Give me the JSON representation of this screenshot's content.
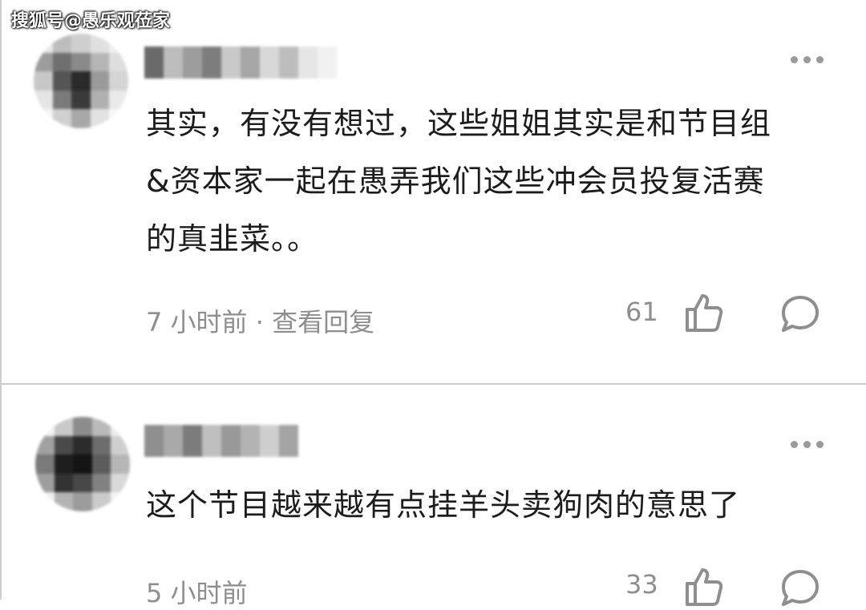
{
  "watermark": "搜狐号@愚乐观莅家",
  "comments": [
    {
      "lines": [
        "其实，有没有想过，这些姐姐其实是和节目组",
        "&资本家一起在愚弄我们这些冲会员投复活赛",
        "的真韭菜。。"
      ],
      "time": "7 小时前",
      "separator": "·",
      "reply_link": "查看回复",
      "likes": "61"
    },
    {
      "lines": [
        "这个节目越来越有点挂羊头卖狗肉的意思了"
      ],
      "time": "5 小时前",
      "likes": "33"
    }
  ],
  "icons": {
    "more": "more-dots-icon",
    "like": "thumbs-up-icon",
    "reply": "comment-bubble-icon"
  },
  "colors": {
    "text": "#1c1c1c",
    "meta": "#8e8e8e",
    "icon": "#9a9a9a"
  }
}
